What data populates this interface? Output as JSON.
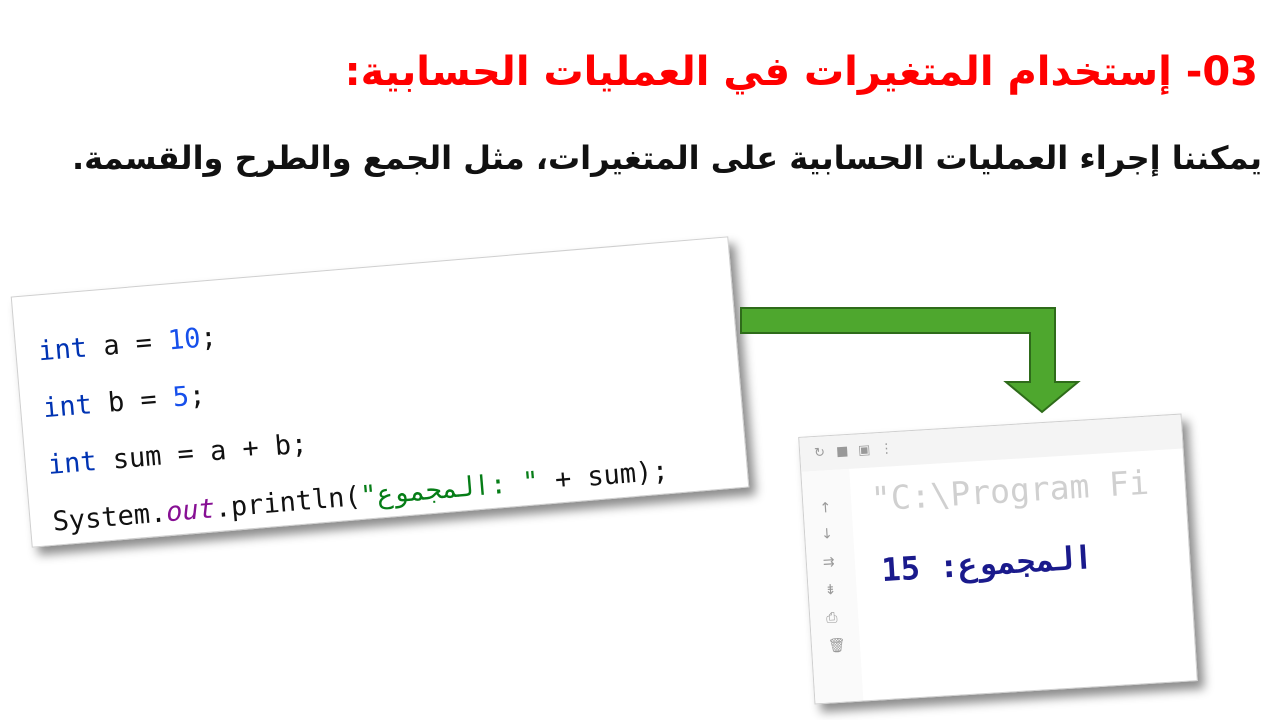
{
  "title": "03-  إستخدام المتغيرات في العمليات الحسابية:",
  "subtitle": "يمكننا إجراء العمليات الحسابية على المتغيرات، مثل الجمع والطرح والقسمة.",
  "code": {
    "line1": {
      "kw": "int",
      "mid": " a = ",
      "num": "10",
      "end": ";"
    },
    "line2": {
      "kw": "int",
      "mid": " b = ",
      "num": "5",
      "end": ";"
    },
    "line3": {
      "kw": "int",
      "mid": " sum = a + b;"
    },
    "line4": {
      "start": "System.",
      "field": "out",
      "call": ".println(",
      "str": "\"المجموع: \"",
      "end": " + sum);"
    }
  },
  "console": {
    "path": "\"C:\\Program Fi",
    "output_label": "المجموع:",
    "output_value": "15"
  },
  "colors": {
    "title": "#ff0000",
    "arrow_fill": "#4ea72e",
    "arrow_stroke": "#2e6b1a"
  }
}
